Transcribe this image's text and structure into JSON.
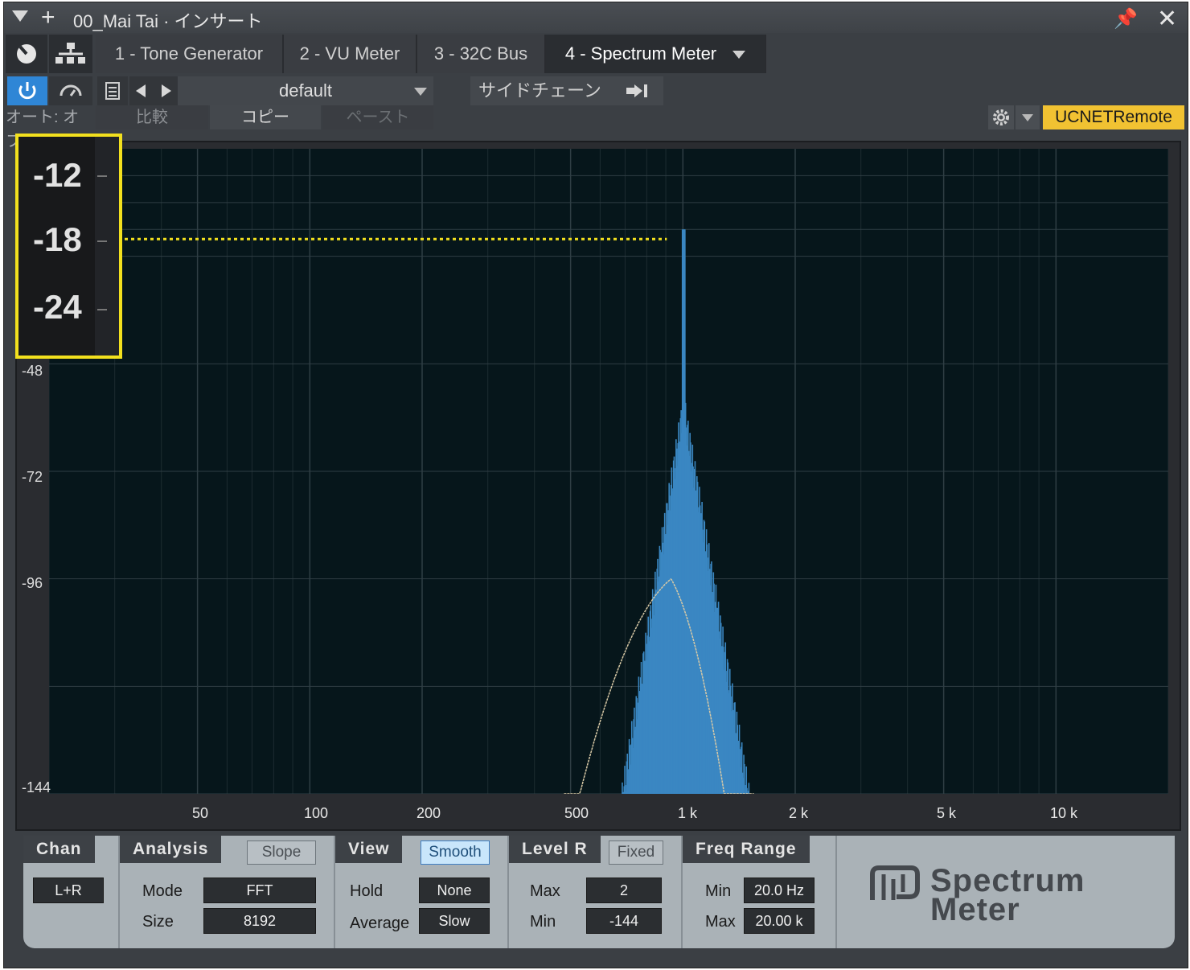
{
  "window": {
    "title": "00_Mai Tai · インサート"
  },
  "tabs": [
    {
      "label": "1 - Tone Generator"
    },
    {
      "label": "2 - VU Meter"
    },
    {
      "label": "3 - 32C Bus"
    },
    {
      "label": "4 - Spectrum Meter"
    }
  ],
  "toolbar": {
    "preset": "default",
    "sidechain": "サイドチェーン",
    "auto": "オート: オフ",
    "compare": "比較",
    "copy": "コピー",
    "paste": "ペースト",
    "remote": "UCNETRemote"
  },
  "analyzer": {
    "y_ticks": [
      "-48",
      "-72",
      "-96",
      "-144"
    ],
    "zoom_ticks": [
      "-12",
      "-18",
      "-24"
    ],
    "x_ticks": [
      "50",
      "100",
      "200",
      "500",
      "1 k",
      "2 k",
      "5 k",
      "10 k"
    ]
  },
  "chart_data": {
    "type": "area",
    "x_scale": "log",
    "xlim": [
      20,
      20000
    ],
    "ylim": [
      -144,
      0
    ],
    "peak_freq": 1000,
    "peak_level": -18,
    "smooth_peak_level": -96,
    "highlight_color": "#f2e01e",
    "spectrum_color": "#3a87c2",
    "smooth_color": "#d8c9a6"
  },
  "controls": {
    "chan": {
      "title": "Chan",
      "value": "L+R"
    },
    "analysis": {
      "title": "Analysis",
      "toggle": "Slope",
      "mode_label": "Mode",
      "mode": "FFT",
      "size_label": "Size",
      "size": "8192"
    },
    "view": {
      "title": "View",
      "toggle": "Smooth",
      "hold_label": "Hold",
      "hold": "None",
      "avg_label": "Average",
      "avg": "Slow"
    },
    "level": {
      "title": "Level R",
      "toggle": "Fixed",
      "max_label": "Max",
      "max": "2",
      "min_label": "Min",
      "min": "-144"
    },
    "freq": {
      "title": "Freq Range",
      "min_label": "Min",
      "min": "20.0 Hz",
      "max_label": "Max",
      "max": "20.00 k"
    }
  },
  "brand": {
    "line1": "Spectrum",
    "line2": "Meter"
  }
}
